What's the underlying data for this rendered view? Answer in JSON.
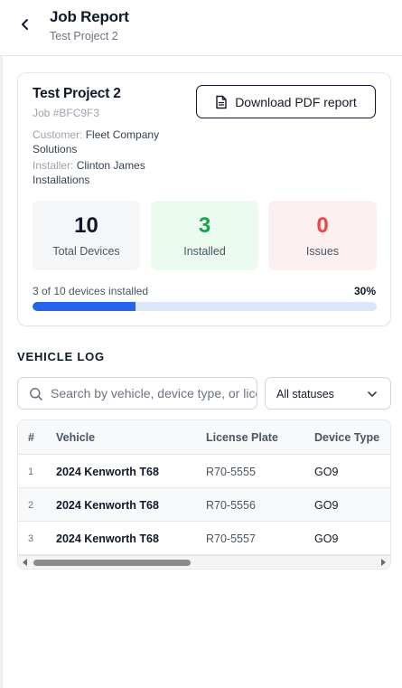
{
  "header": {
    "title": "Job Report",
    "subtitle": "Test Project 2",
    "back_icon": "chevron-left-icon"
  },
  "project": {
    "name": "Test Project 2",
    "job_id": "Job #BFC9F3",
    "customer_label": "Customer:",
    "customer_value": "Fleet Company Solutions",
    "installer_label": "Installer:",
    "installer_value": "Clinton James Installations",
    "download_label": "Download PDF report",
    "download_icon": "file-text-icon"
  },
  "stats": {
    "total": {
      "value": "10",
      "label": "Total Devices"
    },
    "installed": {
      "value": "3",
      "label": "Installed"
    },
    "issues": {
      "value": "0",
      "label": "Issues"
    },
    "colors": {
      "installed": "#16a34a",
      "issues": "#ef4444"
    }
  },
  "progress": {
    "text": "3 of 10 devices installed",
    "percent_label": "30%",
    "fraction": 0.3,
    "color": "#2563eb"
  },
  "vehicle_log": {
    "title": "VEHICLE LOG",
    "search_placeholder": "Search by vehicle, device type, or license plate",
    "status_filter": "All statuses",
    "columns": [
      "#",
      "Vehicle",
      "License Plate",
      "Device Type"
    ],
    "rows": [
      {
        "idx": "1",
        "vehicle": "2024 Kenworth T68",
        "plate": "R70-5555",
        "device": "GO9"
      },
      {
        "idx": "2",
        "vehicle": "2024 Kenworth T68",
        "plate": "R70-5556",
        "device": "GO9"
      },
      {
        "idx": "3",
        "vehicle": "2024 Kenworth T68",
        "plate": "R70-5557",
        "device": "GO9"
      }
    ]
  }
}
